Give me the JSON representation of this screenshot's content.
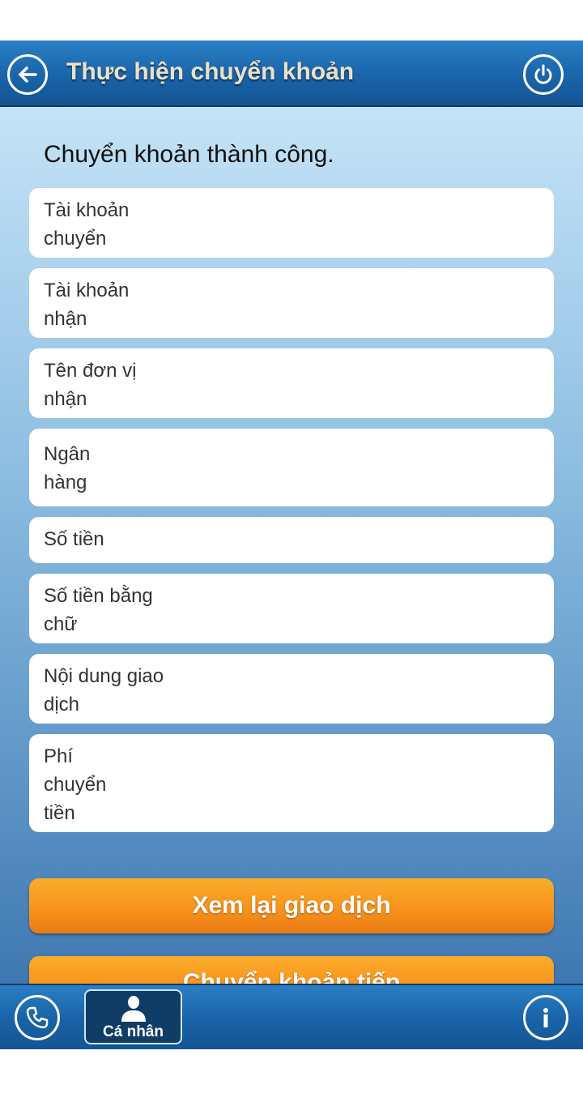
{
  "header": {
    "title": "Thực hiện chuyển khoản",
    "back_icon": "back-arrow-icon",
    "power_icon": "power-icon"
  },
  "main": {
    "success_message": "Chuyển khoản thành công.",
    "fields": [
      {
        "label": "Tài khoản chuyển",
        "value": ""
      },
      {
        "label": "Tài khoản nhận",
        "value": ""
      },
      {
        "label": "Tên đơn vị nhận",
        "value": ""
      },
      {
        "label": "Ngân hàng",
        "value": ""
      },
      {
        "label": "Số tiền",
        "value": ""
      },
      {
        "label": "Số tiền bằng chữ",
        "value": ""
      },
      {
        "label": "Nội dung giao dịch",
        "value": ""
      },
      {
        "label": "Phí chuyển tiền",
        "value": ""
      }
    ],
    "review_button": "Xem lại giao dịch",
    "continue_button": "Chuyển khoản tiếp"
  },
  "tabbar": {
    "phone_icon": "phone-icon",
    "personal_label": "Cá nhân",
    "personal_icon": "user-icon",
    "info_icon": "info-icon"
  },
  "colors": {
    "header_blue": "#1a64aa",
    "button_orange": "#f7941d",
    "header_title": "#e9e1c9"
  }
}
